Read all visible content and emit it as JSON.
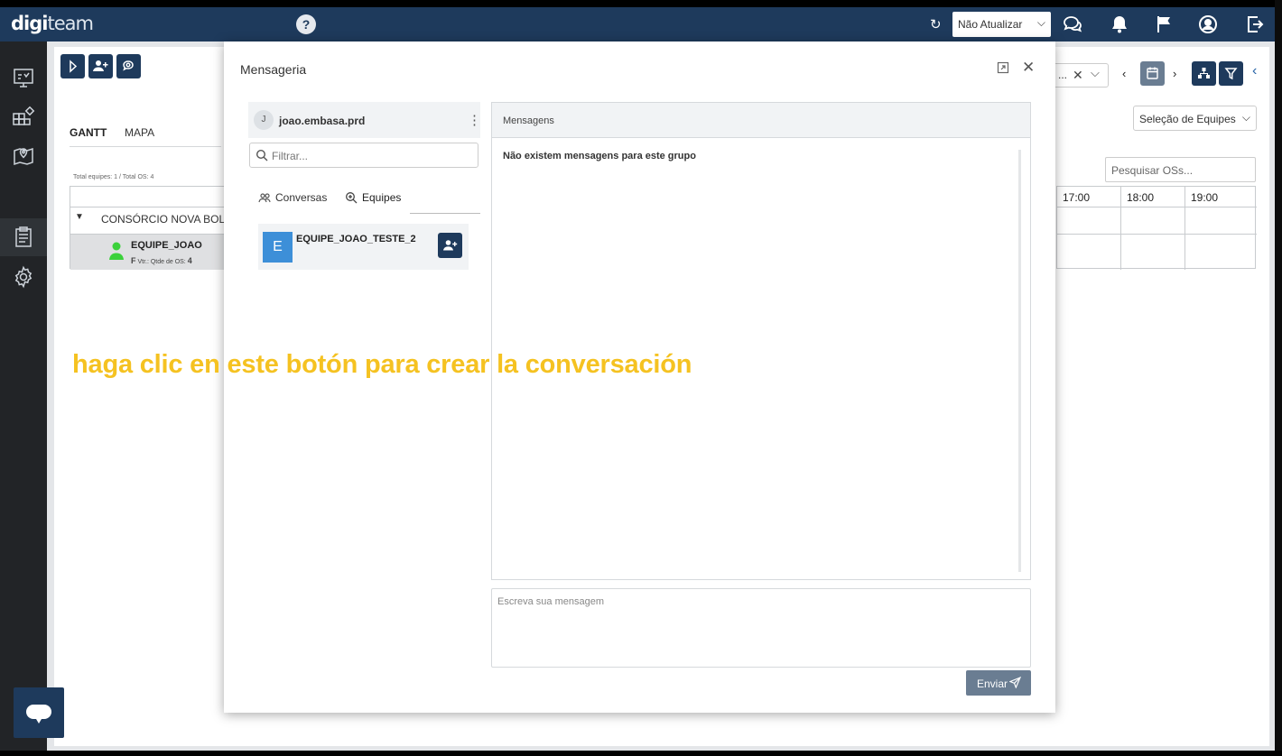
{
  "app": {
    "logo_digi": "digi",
    "logo_team": "team"
  },
  "topbar": {
    "update_select_value": "Não Atualizar",
    "icons": [
      "help-icon",
      "refresh-icon",
      "chat-bubbles-icon",
      "bell-icon",
      "flag-icon",
      "user-circle-icon",
      "logout-icon"
    ]
  },
  "sidebar": {
    "icons": [
      "dashboard-icon",
      "grid-icon",
      "map-icon",
      "clipboard-icon",
      "gear-icon"
    ]
  },
  "background": {
    "tabs": {
      "gantt": "GANTT",
      "mapa": "MAPA"
    },
    "summary": "Total equipes: 1 / Total OS: 4",
    "group_name": "CONSÓRCIO NOVA BOLAN",
    "team": {
      "name": "EQUIPE_JOAO",
      "meta_prefix": "F",
      "meta_label": "Vtr.: Qtde de OS:",
      "meta_count": "4"
    },
    "equipes_select": "Seleção de Equipes",
    "search_placeholder": "Pesquisar OSs...",
    "truncated_select": "...",
    "hours": [
      "17:00",
      "18:00",
      "19:00"
    ]
  },
  "modal": {
    "title": "Mensageria",
    "user": {
      "initial": "J",
      "name": "joao.embasa.prd"
    },
    "filter_placeholder": "Filtrar...",
    "tabs": {
      "conversas": "Conversas",
      "equipes": "Equipes"
    },
    "team_card": {
      "initial": "E",
      "name": "EQUIPE_JOAO_TESTE_2"
    },
    "messages_header": "Mensagens",
    "empty_text": "Não existem mensagens para este grupo",
    "message_placeholder": "Escreva sua mensagem",
    "send_label": "Enviar"
  },
  "overlay": {
    "caption": "haga clic en este botón para crear la conversación",
    "caption_color": "#f5c221"
  },
  "colors": {
    "navy": "#1e3a5c",
    "slate": "#6a7d92",
    "avatar_blue": "#3d8fd8"
  }
}
